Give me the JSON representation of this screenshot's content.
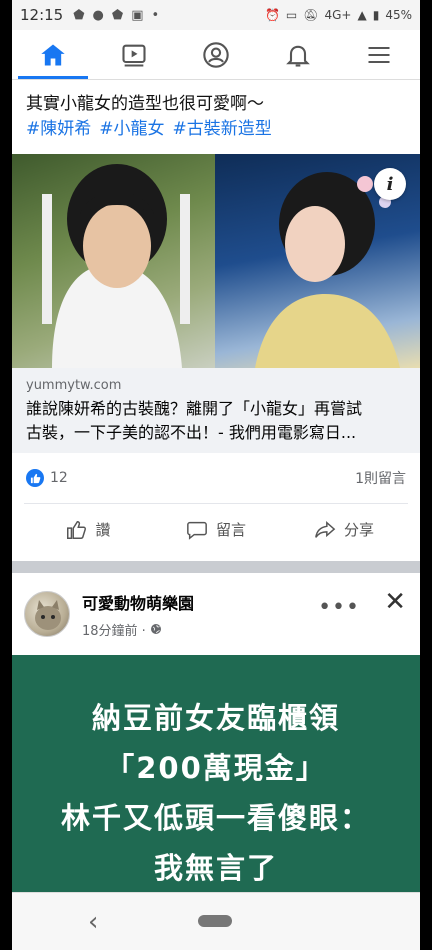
{
  "status_bar": {
    "time": "12:15",
    "network": "4G+",
    "battery": "45%"
  },
  "nav": {
    "items": [
      {
        "name": "home",
        "icon": "home-icon",
        "active": true
      },
      {
        "name": "watch",
        "icon": "video-icon",
        "active": false
      },
      {
        "name": "profile",
        "icon": "profile-icon",
        "active": false
      },
      {
        "name": "notifications",
        "icon": "bell-icon",
        "active": false
      },
      {
        "name": "menu",
        "icon": "hamburger-menu-icon",
        "active": false
      }
    ],
    "accent_color": "#1877f2"
  },
  "post1": {
    "text": "其實小龍女的造型也很可愛啊～",
    "hashtags": [
      "#陳妍希",
      "#小龍女",
      "#古裝新造型"
    ],
    "link": {
      "domain": "yummytw.com",
      "title_line1": "誰說陳妍希的古裝醜？離開了「小龍女」再嘗試",
      "title_line2": "古裝，一下子美的認不出！- 我們用電影寫日..."
    },
    "likes": "12",
    "comments": "1則留言",
    "actions": {
      "like": "讚",
      "comment": "留言",
      "share": "分享"
    }
  },
  "post2": {
    "page_name": "可愛動物萌樂園",
    "time": "18分鐘前 ·",
    "card_lines": [
      "納豆前女友臨櫃領",
      "「200萬現金」",
      "林千又低頭一看傻眼：",
      "我無言了"
    ],
    "card_color": "#1f6a52"
  }
}
